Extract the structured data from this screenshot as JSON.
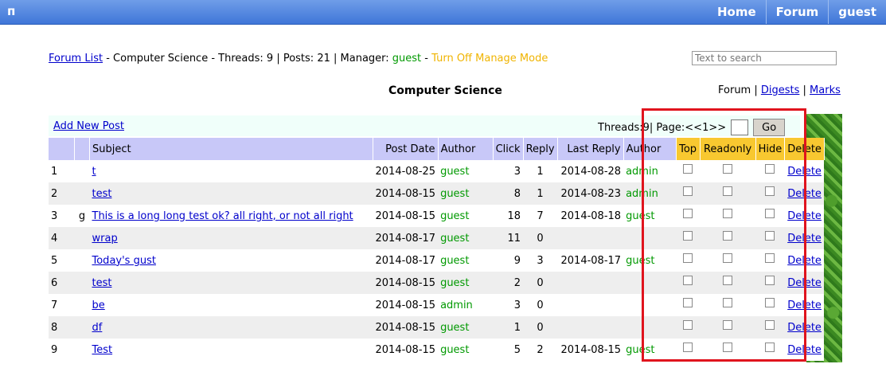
{
  "header": {
    "logo": "п",
    "nav": [
      "Home",
      "Forum",
      "guest"
    ]
  },
  "info": {
    "forum_list": "Forum List",
    "sep1": " - ",
    "board": "Computer Science",
    "sep2": " - Threads: ",
    "threads": "9",
    "sep3": " | Posts: ",
    "posts": "21",
    "sep4": " | Manager: ",
    "manager": "guest",
    "sep5": " - ",
    "manage_mode": "Turn Off Manage Mode"
  },
  "search": {
    "placeholder": "Text to search"
  },
  "board_title": "Computer Science",
  "views": {
    "forum": "Forum",
    "sep": " | ",
    "digests": "Digests",
    "marks": "Marks"
  },
  "toolbar": {
    "add_post": "Add New Post",
    "threads_label": "Threads: ",
    "threads_count": "9",
    "page_label": " | Page: ",
    "prev": "<<",
    "page": " 1 ",
    "next": ">>",
    "go": "Go"
  },
  "table": {
    "headers": [
      "",
      "",
      "Subject",
      "Post Date",
      "Author",
      "Click",
      "Reply",
      "Last Reply",
      "Author",
      "Top",
      "Readonly",
      "Hide",
      "Delete"
    ],
    "rows": [
      {
        "no": "1",
        "flag": "",
        "subject": "t",
        "post_date": "2014-08-25",
        "author": "guest",
        "click": "3",
        "reply": "1",
        "last_reply": "2014-08-28",
        "last_author": "admin",
        "delete": "Delete"
      },
      {
        "no": "2",
        "flag": "",
        "subject": "test",
        "post_date": "2014-08-15",
        "author": "guest",
        "click": "8",
        "reply": "1",
        "last_reply": "2014-08-23",
        "last_author": "admin",
        "delete": "Delete"
      },
      {
        "no": "3",
        "flag": "g",
        "subject": "This is a long long test ok? all right, or not all right",
        "post_date": "2014-08-15",
        "author": "guest",
        "click": "18",
        "reply": "7",
        "last_reply": "2014-08-18",
        "last_author": "guest",
        "delete": "Delete"
      },
      {
        "no": "4",
        "flag": "",
        "subject": "wrap",
        "post_date": "2014-08-17",
        "author": "guest",
        "click": "11",
        "reply": "0",
        "last_reply": "",
        "last_author": "",
        "delete": "Delete"
      },
      {
        "no": "5",
        "flag": "",
        "subject": "Today's gust",
        "post_date": "2014-08-17",
        "author": "guest",
        "click": "9",
        "reply": "3",
        "last_reply": "2014-08-17",
        "last_author": "guest",
        "delete": "Delete"
      },
      {
        "no": "6",
        "flag": "",
        "subject": "test",
        "post_date": "2014-08-15",
        "author": "guest",
        "click": "2",
        "reply": "0",
        "last_reply": "",
        "last_author": "",
        "delete": "Delete"
      },
      {
        "no": "7",
        "flag": "",
        "subject": "be",
        "post_date": "2014-08-15",
        "author": "admin",
        "click": "3",
        "reply": "0",
        "last_reply": "",
        "last_author": "",
        "delete": "Delete"
      },
      {
        "no": "8",
        "flag": "",
        "subject": "df",
        "post_date": "2014-08-15",
        "author": "guest",
        "click": "1",
        "reply": "0",
        "last_reply": "",
        "last_author": "",
        "delete": "Delete"
      },
      {
        "no": "9",
        "flag": "",
        "subject": "Test",
        "post_date": "2014-08-15",
        "author": "guest",
        "click": "5",
        "reply": "2",
        "last_reply": "2014-08-15",
        "last_author": "guest",
        "delete": "Delete"
      }
    ]
  },
  "colors": {
    "topbar": "#3f76d8",
    "header_bg": "#c8c8f8",
    "admin_header_bg": "#f8c830",
    "author_green": "#009900",
    "manage_mode_orange": "#f0b400",
    "highlight_red": "#e0141e"
  }
}
